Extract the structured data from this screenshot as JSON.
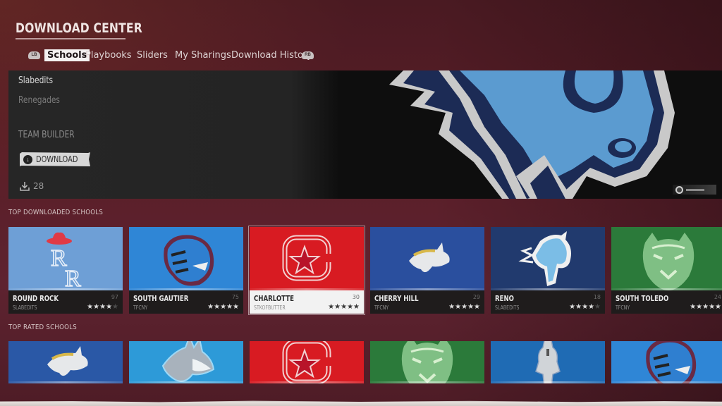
{
  "header": {
    "title": "DOWNLOAD CENTER",
    "left_bumper": "LB",
    "right_bumper": "RB",
    "tabs": [
      {
        "label": "Schools",
        "active": true
      },
      {
        "label": "Playbooks",
        "active": false
      },
      {
        "label": "Sliders",
        "active": false
      },
      {
        "label": "My Sharings",
        "active": false
      },
      {
        "label": "Download History",
        "active": false
      }
    ]
  },
  "featured": {
    "author": "Slabedits",
    "team_name": "Renegades",
    "category": "TEAM BUILDER",
    "download_button": "DOWNLOAD",
    "download_count": "28",
    "art_icon": "horse-mascot-logo",
    "colors": {
      "primary": "#5b9bd0",
      "secondary": "#1b2a55",
      "accent": "#c8c8c8"
    }
  },
  "sections": {
    "top_downloaded": {
      "label": "TOP DOWNLOADED SCHOOLS",
      "cards": [
        {
          "name": "ROUND ROCK",
          "author": "SLABEDITS",
          "count": "97",
          "rating": 4,
          "max_rating": 5,
          "bg": "#6e9fd6",
          "logo": "rr-cowboy-hat-logo",
          "selected": false
        },
        {
          "name": "SOUTH GAUTIER",
          "author": "TFCNY",
          "count": "75",
          "rating": 5,
          "max_rating": 5,
          "bg": "#2f86d6",
          "logo": "tiger-logo",
          "selected": false
        },
        {
          "name": "CHARLOTTE",
          "author": "STKOFBUTTER",
          "count": "30",
          "rating": 5,
          "max_rating": 5,
          "bg": "#d81b22",
          "logo": "c-star-logo",
          "selected": true
        },
        {
          "name": "CHERRY HILL",
          "author": "TFCNY",
          "count": "29",
          "rating": 5,
          "max_rating": 5,
          "bg": "#2a4f9e",
          "logo": "bull-logo",
          "selected": false
        },
        {
          "name": "RENO",
          "author": "SLABEDITS",
          "count": "18",
          "rating": 4,
          "max_rating": 5,
          "bg": "#213a6e",
          "logo": "horse-logo",
          "selected": false
        },
        {
          "name": "SOUTH TOLEDO",
          "author": "TFCNY",
          "count": "24",
          "rating": 5,
          "max_rating": 5,
          "bg": "#2b7a3a",
          "logo": "green-tiger-logo",
          "selected": false
        }
      ]
    },
    "top_rated": {
      "label": "TOP RATED SCHOOLS",
      "cards": [
        {
          "bg": "#2a58a6",
          "logo": "bull-logo"
        },
        {
          "bg": "#2d9ad8",
          "logo": "husky-logo"
        },
        {
          "bg": "#d81b22",
          "logo": "c-star-logo"
        },
        {
          "bg": "#2b7a3a",
          "logo": "green-tiger-logo"
        },
        {
          "bg": "#1f6bb4",
          "logo": "knight-logo"
        },
        {
          "bg": "#2f86d6",
          "logo": "tiger-logo"
        }
      ]
    }
  }
}
